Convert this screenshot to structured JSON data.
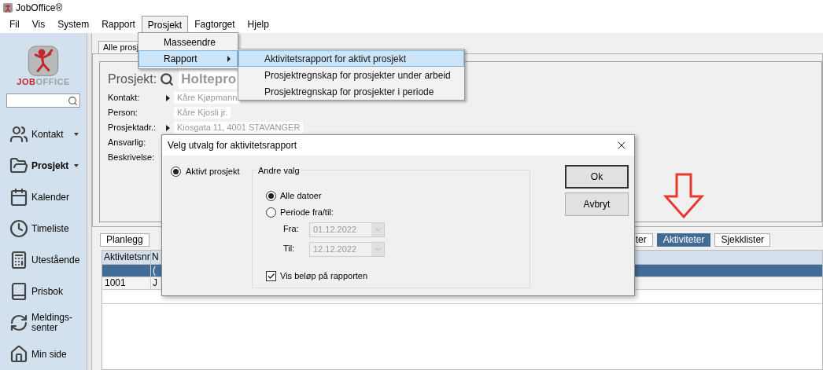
{
  "window": {
    "title": "JobOffice®"
  },
  "menu_bar": [
    {
      "label": "Fil",
      "selected": false
    },
    {
      "label": "Vis",
      "selected": false
    },
    {
      "label": "System",
      "selected": false
    },
    {
      "label": "Rapport",
      "selected": false
    },
    {
      "label": "Prosjekt",
      "selected": true
    },
    {
      "label": "Fagtorget",
      "selected": false
    },
    {
      "label": "Hjelp",
      "selected": false
    }
  ],
  "sidebar": {
    "logo": {
      "parts": [
        "JOB",
        "OFFICE"
      ]
    },
    "items": [
      {
        "label": "Kontakt",
        "selected": false,
        "has_menu": true
      },
      {
        "label": "Prosjekt",
        "selected": true,
        "has_menu": true
      },
      {
        "label": "Kalender",
        "selected": false,
        "has_menu": false
      },
      {
        "label": "Timeliste",
        "selected": false,
        "has_menu": false
      },
      {
        "label": "Utestående",
        "selected": false,
        "has_menu": false
      },
      {
        "label": "Prisbok",
        "selected": false,
        "has_menu": false
      },
      {
        "label": "Meldings-senter",
        "selected": false,
        "has_menu": false
      },
      {
        "label": "Min side",
        "selected": false,
        "has_menu": false
      }
    ]
  },
  "main_tab": {
    "label": "Alle prosj",
    "selected": true
  },
  "project": {
    "label": "Prosjekt:",
    "name": "Holtepro"
  },
  "fields": [
    {
      "label": "Kontakt:",
      "value": "Kåre Kjøpmann",
      "link": true
    },
    {
      "label": "Person:",
      "value": "Kåre Kjosli jr.",
      "link": false
    },
    {
      "label": "Prosjektadr.:",
      "value": "Kiosgata 11, 4001 STAVANGER",
      "link": true
    },
    {
      "label": "Ansvarlig:"
    },
    {
      "label": "Beskrivelse:"
    }
  ],
  "bottom_tabs": [
    {
      "label": "Planlegg",
      "selected": false
    },
    {
      "label": "ter",
      "selected": false
    },
    {
      "label": "Aktiviteter",
      "selected": true
    },
    {
      "label": "Sjekklister",
      "selected": false
    }
  ],
  "table": {
    "columns": [
      "Aktivitetsnr",
      "N"
    ],
    "rows": [
      {
        "cells": [
          "",
          "("
        ],
        "selected": true
      },
      {
        "cells": [
          "1001",
          "J"
        ],
        "selected": false
      }
    ]
  },
  "menu": {
    "items": [
      {
        "label": "Masseendre",
        "selected": false,
        "submenu": false
      },
      {
        "label": "Rapport",
        "selected": true,
        "submenu": true
      }
    ]
  },
  "submenu": {
    "items": [
      {
        "label": "Aktivitetsrapport for aktivt prosjekt",
        "selected": true
      },
      {
        "label": "Prosjektregnskap for prosjekter under arbeid",
        "selected": false
      },
      {
        "label": "Prosjektregnskap for prosjekter i periode",
        "selected": false
      }
    ]
  },
  "dialog": {
    "title": "Velg utvalg for aktivitetsrapport",
    "scope": {
      "label": "Aktivt prosjekt",
      "selected": true
    },
    "group": {
      "title": "Andre valg",
      "options": [
        {
          "label": "Alle datoer",
          "selected": true
        },
        {
          "label": "Periode fra/til:",
          "selected": false
        }
      ],
      "date_fields": [
        {
          "label": "Fra:",
          "value": "01.12.2022",
          "disabled": true
        },
        {
          "label": "Til:",
          "value": "12.12.2022",
          "disabled": true
        }
      ],
      "show_amounts": {
        "label": "Vis beløp på rapporten",
        "checked": true
      }
    },
    "buttons": [
      {
        "label": "Ok",
        "default": true
      },
      {
        "label": "Avbryt",
        "default": false
      }
    ]
  }
}
